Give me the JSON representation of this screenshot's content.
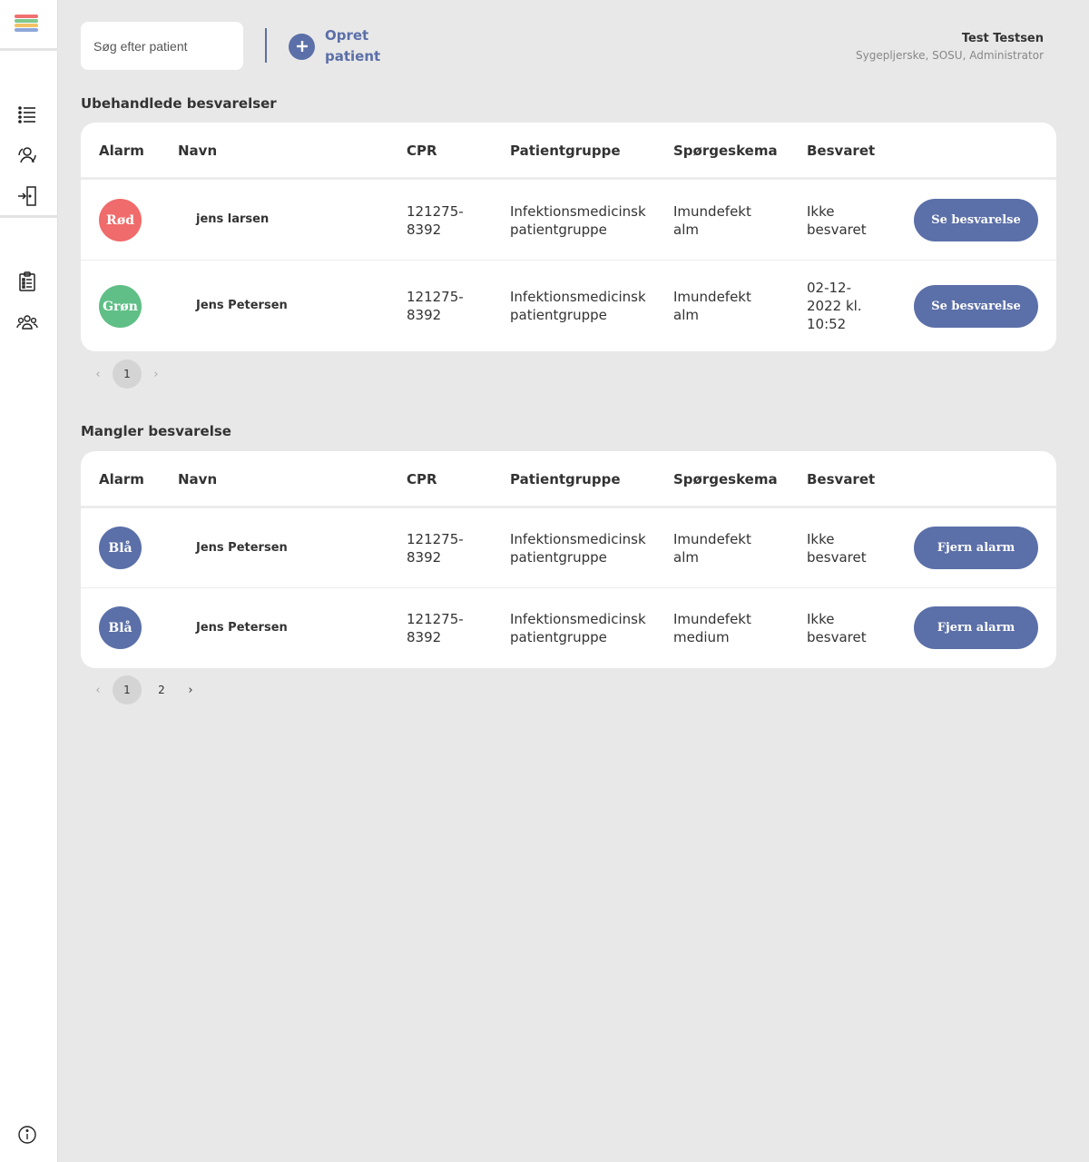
{
  "colors": {
    "accent": "#5b6fa8",
    "red": "#f06b6b",
    "green": "#5fbf86",
    "blue": "#5b6fa8",
    "logo": [
      "#f07070",
      "#7fc98f",
      "#f2c265",
      "#8ea7d9"
    ]
  },
  "sidebar": {
    "icons": [
      "list-icon",
      "patient-sync-icon",
      "logout-icon",
      "clipboard-icon",
      "group-icon",
      "info-icon"
    ]
  },
  "search": {
    "placeholder": "Søg efter patient",
    "value": ""
  },
  "create": {
    "label": "Opret patient"
  },
  "user": {
    "name": "Test Testsen",
    "roles": "Sygepljerske, SOSU, Administrator"
  },
  "columns": {
    "alarm": "Alarm",
    "name": "Navn",
    "cpr": "CPR",
    "group": "Patientgruppe",
    "questionnaire": "Spørgeskema",
    "answered": "Besvaret"
  },
  "section1": {
    "title": "Ubehandlede besvarelser",
    "rows": [
      {
        "alarm": "Rød",
        "alarm_color": "red",
        "name": "jens larsen",
        "cpr": "121275-8392",
        "group": "Infektionsmedicinsk patientgruppe",
        "questionnaire": "Imundefekt alm",
        "answered": "Ikke besvaret",
        "action": "Se besvarelse"
      },
      {
        "alarm": "Grøn",
        "alarm_color": "green",
        "name": "Jens Petersen",
        "cpr": "121275-8392",
        "group": "Infektionsmedicinsk patientgruppe",
        "questionnaire": "Imundefekt alm",
        "answered": "02-12-2022 kl. 10:52",
        "action": "Se besvarelse"
      }
    ],
    "pages": [
      "1"
    ],
    "current_page": "1"
  },
  "section2": {
    "title": "Mangler besvarelse",
    "rows": [
      {
        "alarm": "Blå",
        "alarm_color": "blue",
        "name": "Jens Petersen",
        "cpr": "121275-8392",
        "group": "Infektionsmedicinsk patientgruppe",
        "questionnaire": "Imundefekt alm",
        "answered": "Ikke besvaret",
        "action": "Fjern alarm"
      },
      {
        "alarm": "Blå",
        "alarm_color": "blue",
        "name": "Jens Petersen",
        "cpr": "121275-8392",
        "group": "Infektionsmedicinsk patientgruppe",
        "questionnaire": "Imundefekt medium",
        "answered": "Ikke besvaret",
        "action": "Fjern alarm"
      }
    ],
    "pages": [
      "1",
      "2"
    ],
    "current_page": "1"
  }
}
